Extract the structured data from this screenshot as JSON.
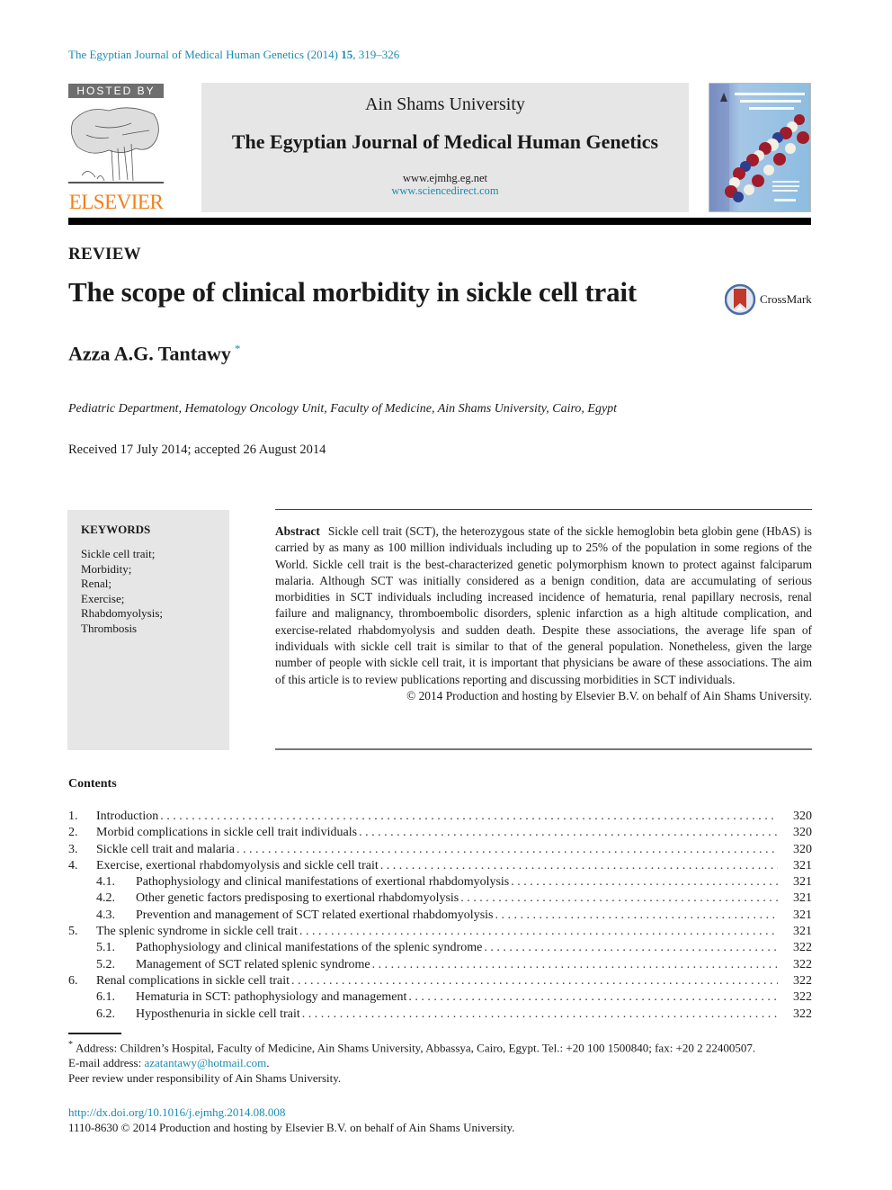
{
  "journal_reference": {
    "text": "The Egyptian Journal of Medical Human Genetics (2014) ",
    "volume": "15",
    "pages": ", 319–326"
  },
  "header": {
    "hosted_by": "HOSTED BY",
    "publisher_logo": "ELSEVIER",
    "university": "Ain Shams University",
    "journal_title": "The Egyptian Journal of Medical Human Genetics",
    "url_journal": "www.ejmhg.eg.net",
    "url_sciencedirect": "www.sciencedirect.com",
    "cover_image": "journal-cover-dna-helix"
  },
  "article": {
    "type": "REVIEW",
    "title": "The scope of clinical morbidity in sickle cell trait",
    "crossmark_label": "CrossMark",
    "author": "Azza A.G. Tantawy",
    "author_marker": "*",
    "affiliation": "Pediatric Department, Hematology Oncology Unit, Faculty of Medicine, Ain Shams University, Cairo, Egypt",
    "dates": "Received 17 July 2014; accepted 26 August 2014"
  },
  "keywords": {
    "heading": "KEYWORDS",
    "items": [
      "Sickle cell trait;",
      "Morbidity;",
      "Renal;",
      "Exercise;",
      "Rhabdomyolysis;",
      "Thrombosis"
    ]
  },
  "abstract": {
    "label": "Abstract",
    "text": "Sickle cell trait (SCT), the heterozygous state of the sickle hemoglobin beta globin gene (HbAS) is carried by as many as 100 million individuals including up to 25% of the population in some regions of the World. Sickle cell trait is the best-characterized genetic polymorphism known to protect against falciparum malaria. Although SCT was initially considered as a benign condition, data are accumulating of serious morbidities in SCT individuals including increased incidence of hematuria, renal papillary necrosis, renal failure and malignancy, thromboembolic disorders, sple­nic infarction as a high altitude complication, and exercise-related rhabdomyolysis and sudden death. Despite these associations, the average life span of individuals with sickle cell trait is similar to that of the general population. Nonetheless, given the large number of people with sickle cell trait, it is important that physicians be aware of these associations. The aim of this article is to review publications reporting and discussing morbidities in SCT individuals.",
    "copyright": "© 2014 Production and hosting by Elsevier B.V. on behalf of Ain Shams University."
  },
  "contents": {
    "heading": "Contents",
    "items": [
      {
        "num": "1.",
        "label": "Introduction",
        "page": "320",
        "level": 1
      },
      {
        "num": "2.",
        "label": "Morbid complications in sickle cell trait individuals",
        "page": "320",
        "level": 1
      },
      {
        "num": "3.",
        "label": "Sickle cell trait and malaria",
        "page": "320",
        "level": 1
      },
      {
        "num": "4.",
        "label": "Exercise, exertional rhabdomyolysis and sickle cell trait",
        "page": "321",
        "level": 1
      },
      {
        "num": "4.1.",
        "label": "Pathophysiology and clinical manifestations of exertional rhabdomyolysis",
        "page": "321",
        "level": 2
      },
      {
        "num": "4.2.",
        "label": "Other genetic factors predisposing to exertional rhabdomyolysis",
        "page": "321",
        "level": 2
      },
      {
        "num": "4.3.",
        "label": "Prevention and management of SCT related exertional rhabdomyolysis",
        "page": "321",
        "level": 2
      },
      {
        "num": "5.",
        "label": "The splenic syndrome in sickle cell trait",
        "page": "321",
        "level": 1
      },
      {
        "num": "5.1.",
        "label": "Pathophysiology and clinical manifestations of the splenic syndrome",
        "page": "322",
        "level": 2
      },
      {
        "num": "5.2.",
        "label": "Management of SCT related splenic syndrome",
        "page": "322",
        "level": 2
      },
      {
        "num": "6.",
        "label": "Renal complications in sickle cell trait",
        "page": "322",
        "level": 1
      },
      {
        "num": "6.1.",
        "label": "Hematuria in SCT: pathophysiology and management",
        "page": "322",
        "level": 2
      },
      {
        "num": "6.2.",
        "label": "Hyposthenuria in sickle cell trait",
        "page": "322",
        "level": 2
      }
    ]
  },
  "footnotes": {
    "marker": "*",
    "address": "Address: Children’s Hospital, Faculty of Medicine, Ain Shams University, Abbassya, Cairo, Egypt. Tel.: +20 100 1500840; fax: +20 2 22400507.",
    "email_label": "E-mail address: ",
    "email": "azatantawy@hotmail.com",
    "email_suffix": ".",
    "peer_review": "Peer review under responsibility of Ain Shams University.",
    "doi": "http://dx.doi.org/10.1016/j.ejmhg.2014.08.008",
    "issn_line": "1110-8630 © 2014 Production and hosting by Elsevier B.V. on behalf of Ain Shams University."
  },
  "colors": {
    "link": "#1a8bb3",
    "elsevier_orange": "#f07f1a",
    "banner_gray": "#e6e6e6",
    "crossmark_red": "#c0392b"
  }
}
